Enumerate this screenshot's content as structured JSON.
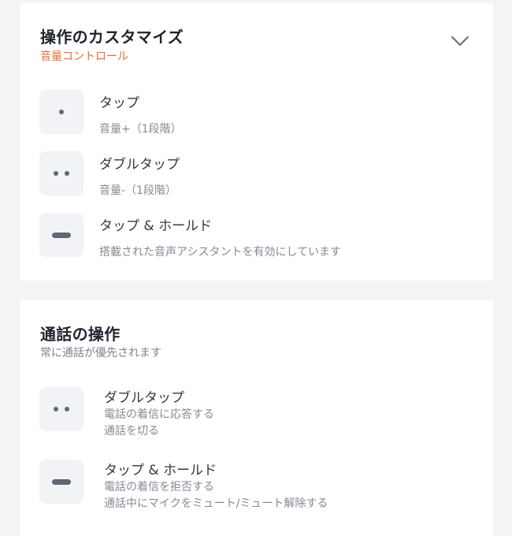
{
  "customize": {
    "title": "操作のカスタマイズ",
    "subtitle": "音量コントロール",
    "accent_color": "#ea6d31",
    "toggle_icon": "chevron-down-icon",
    "gestures": [
      {
        "icon": "single-dot-icon",
        "name": "タップ",
        "description": "音量+（1段階）"
      },
      {
        "icon": "double-dot-icon",
        "name": "ダブルタップ",
        "description": "音量-（1段階）"
      },
      {
        "icon": "hold-bar-icon",
        "name": "タップ & ホールド",
        "description": "搭載された音声アシスタントを有効にしています"
      }
    ]
  },
  "call": {
    "title": "通話の操作",
    "subtitle": "常に通話が優先されます",
    "gestures": [
      {
        "icon": "double-dot-icon",
        "name": "ダブルタップ",
        "lines": [
          "電話の着信に応答する",
          "通話を切る"
        ]
      },
      {
        "icon": "hold-bar-icon",
        "name": "タップ & ホールド",
        "lines": [
          "電話の着信を拒否する",
          "通話中にマイクをミュート/ミュート解除する"
        ]
      }
    ]
  }
}
